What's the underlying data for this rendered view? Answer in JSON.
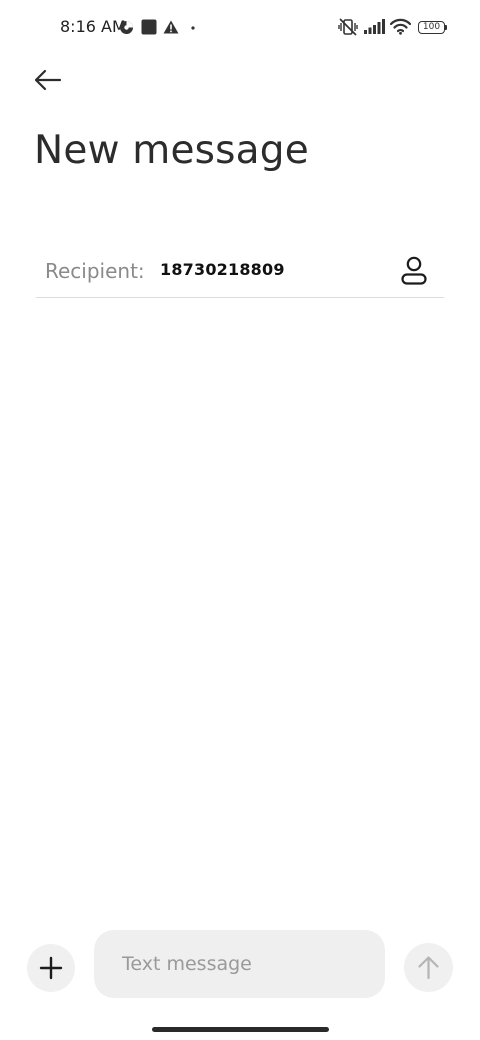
{
  "status_bar": {
    "time": "8:16 AM",
    "battery_level": "100",
    "icons": [
      "app-notification-icon",
      "square-notification-icon",
      "warning-icon",
      "dot-icon",
      "vibrate-off-icon",
      "signal-icon",
      "wifi-icon",
      "battery-icon"
    ]
  },
  "header": {
    "back_icon": "arrow-left-icon",
    "title": "New message"
  },
  "recipient": {
    "label": "Recipient:",
    "value": "18730218809",
    "contact_icon": "person-icon"
  },
  "compose": {
    "add_icon": "plus-icon",
    "input_value": "",
    "input_placeholder": "Text message",
    "send_icon": "arrow-up-icon"
  },
  "colors": {
    "background": "#ffffff",
    "title_text": "#2c2c2c",
    "label_text": "#8a8a8a",
    "input_background": "#efefef",
    "button_background": "#f0f0f0",
    "send_icon_disabled": "#b5b5b5"
  }
}
